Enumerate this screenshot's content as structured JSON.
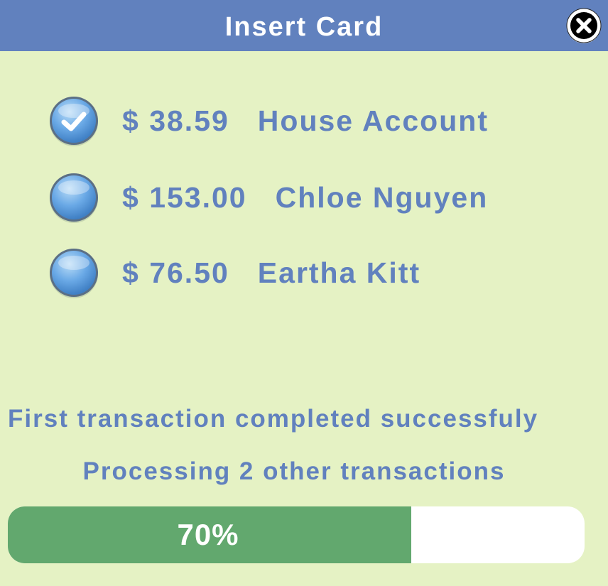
{
  "window": {
    "title": "Insert Card",
    "close_icon": "close-icon"
  },
  "accounts": [
    {
      "amount": "$ 38.59",
      "name": "House Account",
      "selected": true
    },
    {
      "amount": "$ 153.00",
      "name": "Chloe Nguyen",
      "selected": false
    },
    {
      "amount": "$ 76.50",
      "name": "Eartha Kitt",
      "selected": false
    }
  ],
  "status": {
    "line1": "First transaction completed successfuly",
    "line2": "Processing 2 other transactions"
  },
  "progress": {
    "value": 0.7,
    "label": "70%"
  },
  "colors": {
    "background": "#e5f2c4",
    "titlebar": "#6181be",
    "text": "#6181be",
    "progress_fill": "#62a86e",
    "progress_track": "#ffffff"
  }
}
